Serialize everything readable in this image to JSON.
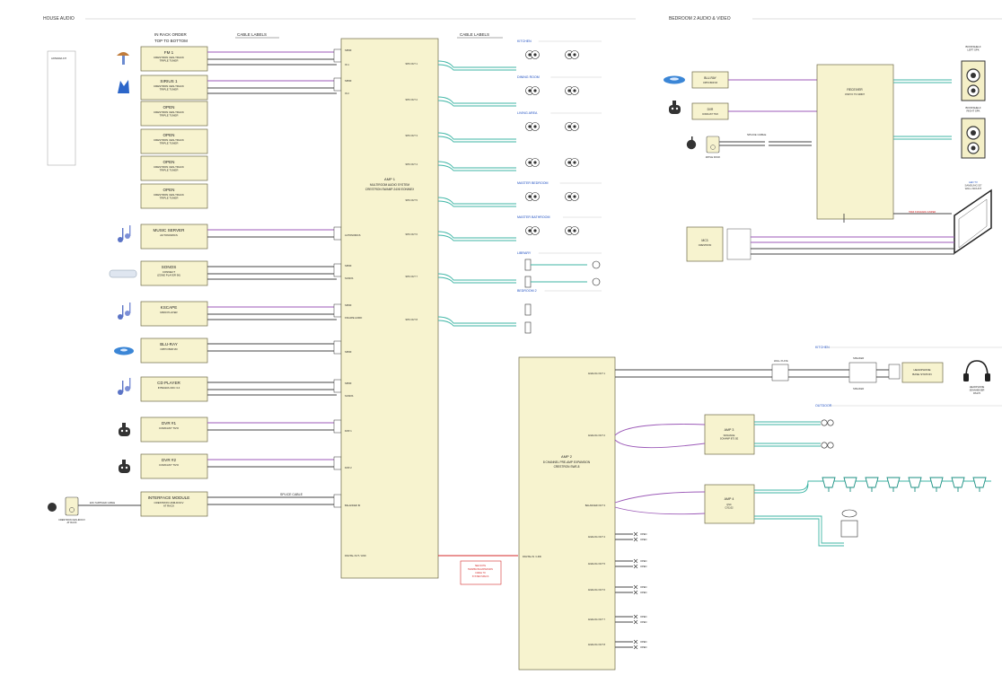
{
  "sections": {
    "house_audio": "HOUSE AUDIO",
    "bedroom2": "BEDROOM 2 AUDIO & VIDEO"
  },
  "headers": {
    "rack_order": "IN RACK ORDER\nTOP TO BOTTOM",
    "cable_labels_1": "CABLE LABELS",
    "cable_labels_2": "CABLE LABELS",
    "splice_cable": "SPLICE CABLE"
  },
  "antenna": {
    "label": "ANTENNA KIT"
  },
  "sources": [
    {
      "title": "FM 1",
      "sub": "CRESTRON CEN-TRACK\nTRIPLE TUNER",
      "icon": "antenna-icon"
    },
    {
      "title": "SIRIUS 1",
      "sub": "CRESTRON CEN-TRACK\nTRIPLE TUNER",
      "icon": "sirius-dog-icon"
    },
    {
      "title": "OPEN",
      "sub": "CRESTRON CEN-TRACK\nTRIPLE TUNER",
      "icon": ""
    },
    {
      "title": "OPEN",
      "sub": "CRESTRON CEN-TRACK\nTRIPLE TUNER",
      "icon": ""
    },
    {
      "title": "OPEN",
      "sub": "CRESTRON CEN-TRACK\nTRIPLE TUNER",
      "icon": ""
    },
    {
      "title": "OPEN",
      "sub": "CRESTRON CEN-TRACK\nTRIPLE TUNER",
      "icon": ""
    },
    {
      "title": "MUSIC SERVER",
      "sub": "AUTONOMICS",
      "icon": "music-notes-icon"
    },
    {
      "title": "SONOS",
      "sub": "CONNECT\n(ZONE PLAYER 90)",
      "icon": "sonos-icon"
    },
    {
      "title": "KSCAPE",
      "sub": "M300 PLAYER",
      "icon": "music-notes-icon"
    },
    {
      "title": "BLU-RAY",
      "sub": "OPPO BDP-83",
      "icon": "bluray-icon"
    },
    {
      "title": "CD PLAYER",
      "sub": "INTEGRA CDC 3.4",
      "icon": "music-notes-icon"
    },
    {
      "title": "DVR #1",
      "sub": "COMCAST TIVO",
      "icon": "tivo-icon"
    },
    {
      "title": "DVR #2",
      "sub": "COMCAST TIVO",
      "icon": "tivo-icon"
    },
    {
      "title": "INTERFACE MODULE",
      "sub": "CRESTRON UDM-DOCV\nAT RACK",
      "icon": ""
    }
  ],
  "ipod": {
    "label": "CRESTRON CEN-IDOCV\nAT RACK",
    "cable": "EXC SUPPLIED CABLE"
  },
  "amp1": {
    "title": "AMP 1",
    "sub": "MULTIROOM AUDIO SYSTEM\nCRESTRON SWAMP-24X8 EONINEX",
    "inputs": [
      "SPDIF",
      "IN 1",
      "SPDIF",
      "IN 2",
      "AUTONOMICS",
      "SPDIF",
      "SONOS",
      "SPDIF",
      "KSCAPE AUDIO",
      "SPDIF",
      "SPDIF",
      "SONOS",
      "DVR 1",
      "DVR 2",
      "BALANCED IN",
      "DIGITAL OUT / LINK"
    ],
    "outputs": [
      "SPK OUT 1",
      "SPK OUT 2",
      "SPK OUT 3",
      "SPK OUT 4",
      "SPK OUT 5",
      "SPK OUT 6",
      "SPK OUT 7",
      "SPK OUT 8"
    ]
  },
  "zones": [
    "KITCHEN",
    "DINING ROOM",
    "LIVING AREA",
    "",
    "MASTER BEDROOM",
    "MASTER BATHROOM",
    "LIBRARY",
    "BEDROOM 2"
  ],
  "amp2": {
    "title": "AMP 2",
    "sub": "8 CHANNEL PRE-AMP EXPANSION\nCRESTRON SWE-8",
    "ports": [
      "ANALOG OUT 1",
      "ANALOG OUT 2",
      "BALANCED OUT 3",
      "ANALOG OUT 4",
      "ANALOG OUT 5",
      "ANALOG OUT 6",
      "ANALOG OUT 7",
      "ANALOG OUT 8"
    ],
    "link_in": "DIGITAL IN / LINK",
    "open_label": "OPEN"
  },
  "link_note": "SEE NOTE\nTERMINATE EXPANSION\nCABLE TO\nSYSTEM SPECS",
  "kitchen_zone": {
    "label": "KITCHEN",
    "pad_label": "SPEAKER",
    "wallplate": "WALL PLATE",
    "hp_base": "HEADPHONE\nBASE STATION",
    "headphone": "HEADPHONE\nSENNHEISER\nRS170"
  },
  "outdoor": {
    "label": "OUTDOOR"
  },
  "amp3": {
    "title": "AMP 3",
    "sub": "SONANCE\nSONAMP 875 SE"
  },
  "amp4": {
    "title": "AMP 4",
    "sub": "QSC\nCX1102"
  },
  "bedroom": {
    "bluray": {
      "title": "BLU-RAY",
      "sub": "OPPO BDP-83"
    },
    "dvr": {
      "title": "DVR",
      "sub": "COMCAST TIVO"
    },
    "dock_label": "APPLE DOCK",
    "splice": "SPLICE CABLE",
    "receiver": {
      "title": "RECEIVER",
      "sub": "ONKYO TX-SR607"
    },
    "mc3": {
      "title": "MC3",
      "sub": "CRESTRON"
    },
    "spk_left": "BOOKSHELF\nLEFT SPK",
    "spk_right": "BOOKSHELF\nRIGHT SPK",
    "tv": "LED TV\nSAMSUNG 55\"\nWALL MOUNT",
    "hdmi": "HDMI STANDARD JUMPER"
  },
  "colors": {
    "box": "#f7f3cf",
    "purple_wire": "#9c5ab8",
    "teal_wire": "#3fb6a6",
    "zone_blue": "#1f4fc2",
    "note_red": "#d42a2a"
  }
}
